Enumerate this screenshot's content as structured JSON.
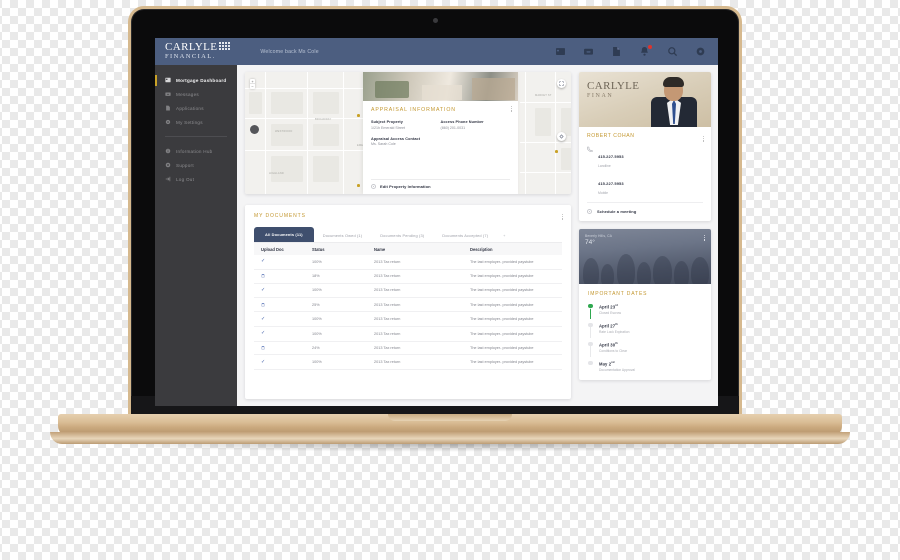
{
  "app": {
    "brand_line1": "CARLYLE",
    "brand_line2": "FINANCIAL.",
    "welcome": "Welcome back Ms Cole"
  },
  "topnav": [
    {
      "name": "dashboard-icon",
      "label": "Dashboard"
    },
    {
      "name": "inbox-icon",
      "label": "Inbox"
    },
    {
      "name": "document-icon",
      "label": "Documents"
    },
    {
      "name": "bell-icon",
      "label": "Notifications",
      "badge": true
    },
    {
      "name": "search-icon",
      "label": "Search"
    },
    {
      "name": "gear-icon",
      "label": "Settings"
    }
  ],
  "sidebar": {
    "primary": [
      {
        "label": "Mortgage Dashboard",
        "icon": "grid-icon",
        "active": true
      },
      {
        "label": "Messages",
        "icon": "envelope-icon",
        "active": false
      },
      {
        "label": "Applications",
        "icon": "file-icon",
        "active": false
      },
      {
        "label": "My Settings",
        "icon": "gear-icon",
        "active": false
      }
    ],
    "secondary": [
      {
        "label": "Information Hub",
        "icon": "info-icon"
      },
      {
        "label": "Support",
        "icon": "lifebuoy-icon"
      },
      {
        "label": "Log Out",
        "icon": "logout-icon"
      }
    ]
  },
  "map": {
    "zoom_in": "+",
    "zoom_out": "−",
    "labels": [
      "WESTWOOD",
      "BROADWAY",
      "EMERALD BLVD",
      "MARKET ST",
      "HIGHLAND",
      "PARKSIDE",
      "GRAND AVE",
      "CEDAR ST"
    ]
  },
  "appraisal": {
    "title": "APPRAISAL INFORMATION",
    "fields": [
      {
        "label": "Subject Property",
        "value": "1/21h Emerald Street"
      },
      {
        "label": "Access Phone Number",
        "value": "(860) 201-0031"
      },
      {
        "label": "Appraisal Access Contact",
        "value": "Ms. Sarah Cole"
      }
    ],
    "action": "Edit Property Information"
  },
  "documents": {
    "title": "MY DOCUMENTS",
    "tabs": [
      {
        "label": "All Documents  (11)",
        "active": true
      },
      {
        "label": "Documents Owed (1)",
        "active": false
      },
      {
        "label": "Documents Pending (3)",
        "active": false
      },
      {
        "label": "Documents Accepted (7)",
        "active": false
      },
      {
        "label": "+",
        "active": false,
        "plus": true
      }
    ],
    "columns": [
      "Upload Doc",
      "Status",
      "Name",
      "Description"
    ],
    "rows": [
      {
        "upload": "check",
        "status": "100%",
        "name": "2013 Tax return",
        "description": "The last employer- provided paystube"
      },
      {
        "upload": "spinner",
        "status": "18%",
        "name": "2013 Tax return",
        "description": "The last employer- provided paystube"
      },
      {
        "upload": "check",
        "status": "100%",
        "name": "2013 Tax return",
        "description": "The last employer- provided paystube"
      },
      {
        "upload": "spinner",
        "status": "25%",
        "name": "2013 Tax return",
        "description": "The last employer- provided paystube"
      },
      {
        "upload": "check",
        "status": "100%",
        "name": "2013 Tax return",
        "description": "The last employer- provided paystube"
      },
      {
        "upload": "check",
        "status": "100%",
        "name": "2013 Tax return",
        "description": "The last employer- provided paystube"
      },
      {
        "upload": "spinner",
        "status": "24%",
        "name": "2013 Tax return",
        "description": "The last employer- provided paystube"
      },
      {
        "upload": "check",
        "status": "100%",
        "name": "2013 Tax return",
        "description": "The last employer- provided paystube"
      }
    ]
  },
  "contact": {
    "banner_line1": "CARLYLE",
    "banner_line2": "FINAN",
    "name": "ROBERT COHAN",
    "phones": [
      {
        "number": "415.227.5953",
        "type": "Landline"
      },
      {
        "number": "415.227.5953",
        "type": "Mobile"
      }
    ],
    "meeting": "Schedule a meeting"
  },
  "weather": {
    "location": "Beverly Hills, CA",
    "temperature": "74°"
  },
  "important_dates": {
    "title": "IMPORTANT DATES",
    "items": [
      {
        "date": "April 23",
        "ord": "rd",
        "note": "Closed Escrow",
        "done": true
      },
      {
        "date": "April 27",
        "ord": "th",
        "note": "Rate Lock Expiration",
        "done": false
      },
      {
        "date": "April 30",
        "ord": "th",
        "note": "Conditions to Clear",
        "done": false
      },
      {
        "date": "May 2",
        "ord": "nd",
        "note": "Documentation Approval",
        "done": false
      }
    ]
  },
  "colors": {
    "topbar": "#4c5e80",
    "sidebar": "#3b3b3e",
    "accent_gold": "#c3972f",
    "tab_active": "#3f4f6e",
    "notification": "#e0342b",
    "timeline_done": "#2fa84f"
  }
}
